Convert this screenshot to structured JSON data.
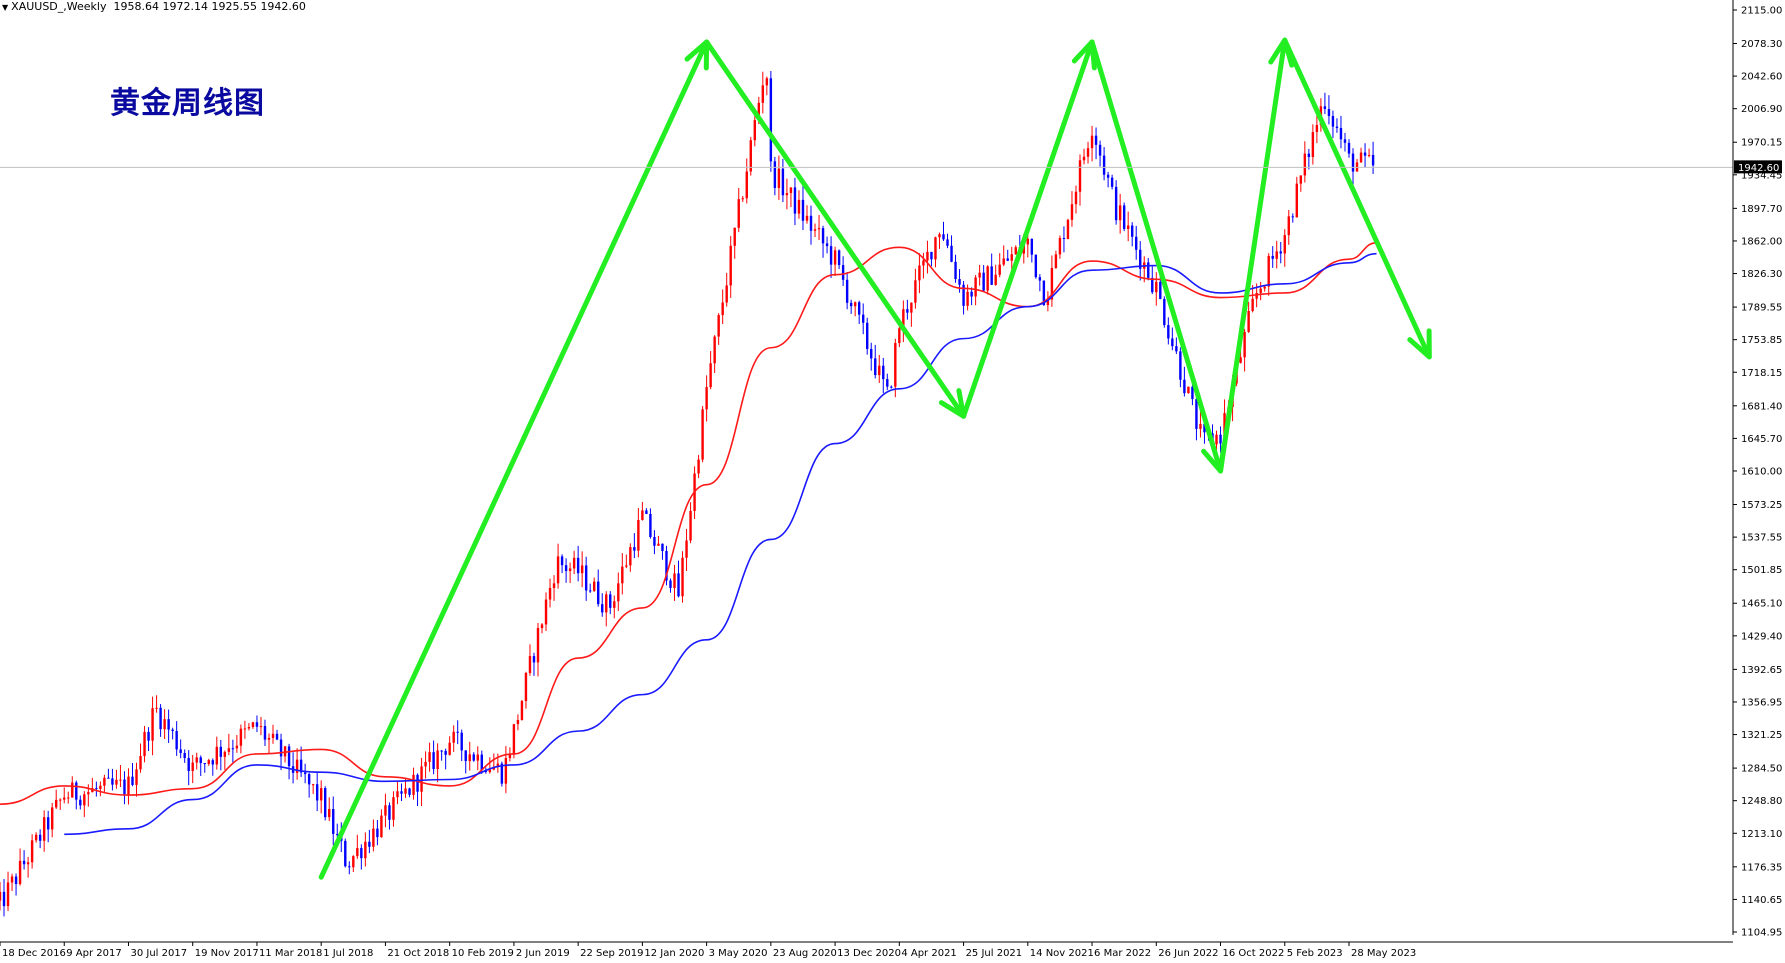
{
  "header": {
    "symbol": "XAUUSD_,Weekly",
    "ohlc": "1958.64 1972.14 1925.55 1942.60"
  },
  "title_cn": "黄金周线图",
  "colors": {
    "bull_candle": "#ff0000",
    "bear_candle": "#0000ff",
    "ma_fast": "#ff1a1a",
    "ma_slow": "#1a1aff",
    "trend_arrows": "#22ee22",
    "price_line": "#c0c0c0",
    "price_tag_bg": "#000000"
  },
  "chart_data": {
    "type": "candlestick",
    "symbol": "XAUUSD",
    "timeframe": "Weekly",
    "ylim": [
      1104.95,
      2115.0
    ],
    "y_ticks": [
      2115.0,
      2078.3,
      2042.6,
      2006.9,
      1970.15,
      1934.45,
      1897.7,
      1862.0,
      1826.3,
      1789.55,
      1753.85,
      1718.15,
      1681.4,
      1645.7,
      1610.0,
      1573.25,
      1537.55,
      1501.85,
      1465.1,
      1429.4,
      1392.65,
      1356.95,
      1321.25,
      1284.5,
      1248.8,
      1213.1,
      1176.35,
      1140.65,
      1104.95
    ],
    "x_ticks": [
      "18 Dec 2016",
      "9 Apr 2017",
      "30 Jul 2017",
      "19 Nov 2017",
      "11 Mar 2018",
      "1 Jul 2018",
      "21 Oct 2018",
      "10 Feb 2019",
      "2 Jun 2019",
      "22 Sep 2019",
      "12 Jan 2020",
      "3 May 2020",
      "23 Aug 2020",
      "13 Dec 2020",
      "4 Apr 2021",
      "25 Jul 2021",
      "14 Nov 2021",
      "6 Mar 2022",
      "26 Jun 2022",
      "16 Oct 2022",
      "5 Feb 2023",
      "28 May 2023"
    ],
    "current_price": 1942.6,
    "price_anchors": [
      [
        "18 Dec 2016",
        1135
      ],
      [
        "9 Apr 2017",
        1255
      ],
      [
        "30 Jul 2017",
        1265
      ],
      [
        "Sep 2017",
        1350
      ],
      [
        "19 Nov 2017",
        1285
      ],
      [
        "11 Mar 2018",
        1330
      ],
      [
        "1 Jul 2018",
        1250
      ],
      [
        "Aug 2018",
        1180
      ],
      [
        "21 Oct 2018",
        1230
      ],
      [
        "10 Feb 2019",
        1315
      ],
      [
        "May 2019",
        1280
      ],
      [
        "Aug 2019",
        1510
      ],
      [
        "22 Sep 2019",
        1500
      ],
      [
        "Nov 2019",
        1460
      ],
      [
        "12 Jan 2020",
        1560
      ],
      [
        "Mar 2020",
        1475
      ],
      [
        "3 May 2020",
        1700
      ],
      [
        "Aug 2020",
        2060
      ],
      [
        "23 Aug 2020",
        1940
      ],
      [
        "13 Dec 2020",
        1840
      ],
      [
        "Mar 2021",
        1690
      ],
      [
        "4 Apr 2021",
        1770
      ],
      [
        "Jun 2021",
        1880
      ],
      [
        "25 Jul 2021",
        1800
      ],
      [
        "14 Nov 2021",
        1860
      ],
      [
        "Dec 2021",
        1800
      ],
      [
        "6 Mar 2022",
        1990
      ],
      [
        "Apr 2022",
        1900
      ],
      [
        "26 Jun 2022",
        1810
      ],
      [
        "Sep 2022",
        1640
      ],
      [
        "16 Oct 2022",
        1650
      ],
      [
        "Dec 2022",
        1800
      ],
      [
        "5 Feb 2023",
        1870
      ],
      [
        "Apr 2023",
        2020
      ],
      [
        "28 May 2023",
        1950
      ],
      [
        "Jul 2023",
        1942.6
      ]
    ],
    "series": [
      {
        "name": "",
        "kind": "ma_fast",
        "points": [
          [
            "18 Dec 2016",
            1245
          ],
          [
            "9 Apr 2017",
            1265
          ],
          [
            "30 Jul 2017",
            1255
          ],
          [
            "19 Nov 2017",
            1262
          ],
          [
            "11 Mar 2018",
            1300
          ],
          [
            "1 Jul 2018",
            1305
          ],
          [
            "21 Oct 2018",
            1275
          ],
          [
            "10 Feb 2019",
            1265
          ],
          [
            "2 Jun 2019",
            1300
          ],
          [
            "22 Sep 2019",
            1405
          ],
          [
            "12 Jan 2020",
            1460
          ],
          [
            "3 May 2020",
            1595
          ],
          [
            "23 Aug 2020",
            1745
          ],
          [
            "13 Dec 2020",
            1825
          ],
          [
            "4 Apr 2021",
            1855
          ],
          [
            "25 Jul 2021",
            1810
          ],
          [
            "14 Nov 2021",
            1790
          ],
          [
            "6 Mar 2022",
            1840
          ],
          [
            "26 Jun 2022",
            1820
          ],
          [
            "16 Oct 2022",
            1800
          ],
          [
            "5 Feb 2023",
            1805
          ],
          [
            "28 May 2023",
            1842
          ],
          [
            "Jul 2023",
            1860
          ]
        ]
      },
      {
        "name": "",
        "kind": "ma_slow",
        "points": [
          [
            "9 Apr 2017",
            1212
          ],
          [
            "30 Jul 2017",
            1218
          ],
          [
            "19 Nov 2017",
            1250
          ],
          [
            "11 Mar 2018",
            1288
          ],
          [
            "1 Jul 2018",
            1280
          ],
          [
            "21 Oct 2018",
            1270
          ],
          [
            "10 Feb 2019",
            1272
          ],
          [
            "2 Jun 2019",
            1288
          ],
          [
            "22 Sep 2019",
            1325
          ],
          [
            "12 Jan 2020",
            1365
          ],
          [
            "3 May 2020",
            1425
          ],
          [
            "23 Aug 2020",
            1535
          ],
          [
            "13 Dec 2020",
            1640
          ],
          [
            "4 Apr 2021",
            1700
          ],
          [
            "25 Jul 2021",
            1755
          ],
          [
            "14 Nov 2021",
            1790
          ],
          [
            "6 Mar 2022",
            1830
          ],
          [
            "26 Jun 2022",
            1835
          ],
          [
            "16 Oct 2022",
            1805
          ],
          [
            "5 Feb 2023",
            1815
          ],
          [
            "28 May 2023",
            1838
          ],
          [
            "Jul 2023",
            1848
          ]
        ]
      }
    ],
    "annotations": [
      {
        "kind": "trend_arrow",
        "from": [
          "1 Jul 2018",
          1165
        ],
        "to": [
          "3 May 2020",
          2080
        ]
      },
      {
        "kind": "trend_arrow",
        "from": [
          "3 May 2020",
          2080
        ],
        "to": [
          "25 Jul 2021",
          1670
        ]
      },
      {
        "kind": "trend_arrow",
        "from": [
          "25 Jul 2021",
          1670
        ],
        "to": [
          "6 Mar 2022",
          2080
        ]
      },
      {
        "kind": "trend_arrow",
        "from": [
          "6 Mar 2022",
          2080
        ],
        "to": [
          "16 Oct 2022",
          1610
        ]
      },
      {
        "kind": "trend_arrow",
        "from": [
          "16 Oct 2022",
          1610
        ],
        "to": [
          "5 Feb 2023",
          2082
        ]
      },
      {
        "kind": "trend_arrow",
        "from": [
          "5 Feb 2023",
          2082
        ],
        "to": [
          "Oct 2023",
          1735
        ]
      }
    ],
    "grid": false,
    "legend": "none"
  }
}
